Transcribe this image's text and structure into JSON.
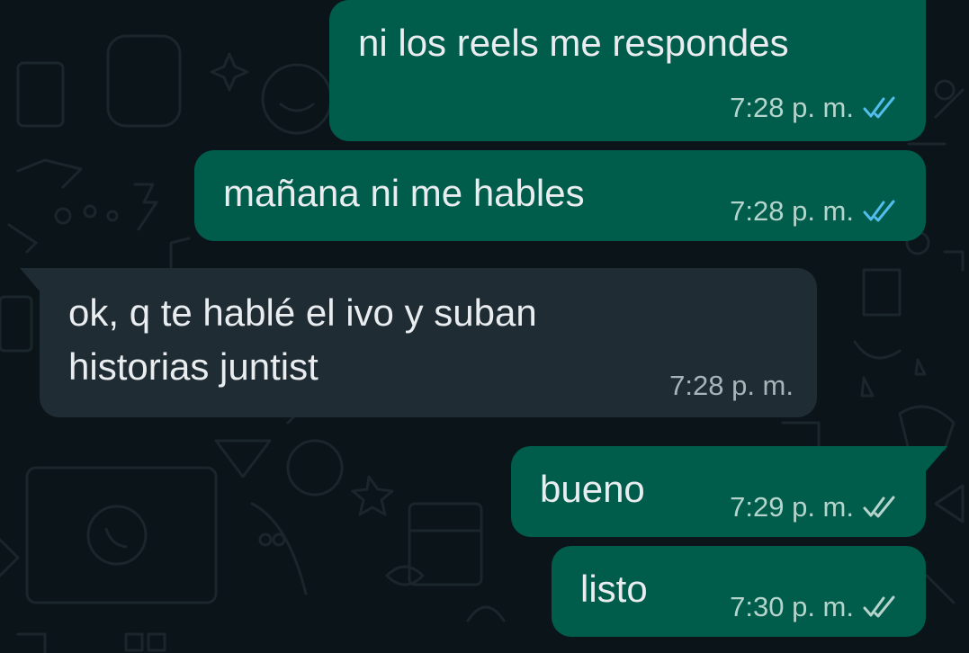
{
  "colors": {
    "background": "#0b1418",
    "outgoing_bubble": "#005c4b",
    "incoming_bubble": "#1f2c34",
    "read_ticks": "#53bdeb",
    "delivered_ticks": "#b5d4cc"
  },
  "messages": [
    {
      "direction": "outgoing",
      "text": "ni los reels me respondes",
      "time": "7:28 p. m.",
      "status": "read",
      "ticks_icon": "double-check-icon"
    },
    {
      "direction": "outgoing",
      "text": "mañana ni me hables",
      "time": "7:28 p. m.",
      "status": "read",
      "ticks_icon": "double-check-icon"
    },
    {
      "direction": "incoming",
      "text_lines": [
        "ok, q te hablé el ivo y suban",
        "historias juntist"
      ],
      "time": "7:28 p. m."
    },
    {
      "direction": "outgoing",
      "text": "bueno",
      "time": "7:29 p. m.",
      "status": "delivered",
      "ticks_icon": "double-check-icon"
    },
    {
      "direction": "outgoing",
      "text": "listo",
      "time": "7:30 p. m.",
      "status": "delivered",
      "ticks_icon": "double-check-icon"
    }
  ]
}
